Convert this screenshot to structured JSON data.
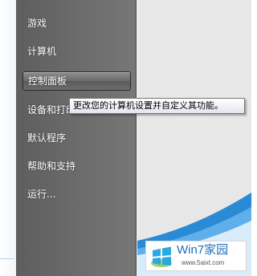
{
  "start_menu": {
    "items": [
      {
        "label": "游戏"
      },
      {
        "label": "计算机"
      },
      {
        "label": "控制面板"
      },
      {
        "label": "设备和打印机"
      },
      {
        "label": "默认程序"
      },
      {
        "label": "帮助和支持"
      },
      {
        "label": "运行..."
      }
    ],
    "highlighted_item": "控制面板"
  },
  "tooltip": {
    "text": "更改您的计算机设置并自定义其功能。"
  },
  "watermark": {
    "title": "Win7家园",
    "url": "www.5aixt.com",
    "logo_icon": "windows-flag-icon"
  },
  "colors": {
    "menu_background": "#6a6a6a",
    "menu_text": "#ffffff",
    "right_panel": "#e9e9e9",
    "accent_blue": "#1f6fb8"
  }
}
